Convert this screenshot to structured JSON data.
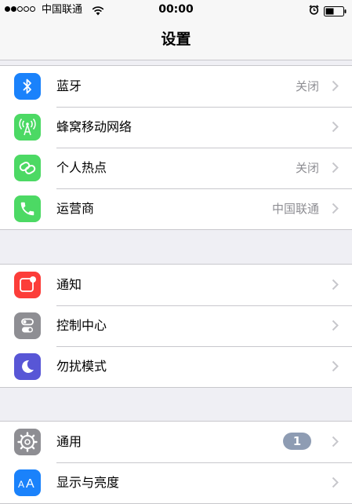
{
  "status_bar": {
    "carrier": "中国联通",
    "time": "00:00"
  },
  "nav": {
    "title": "设置"
  },
  "groups": [
    {
      "rows": [
        {
          "label": "蓝牙",
          "value": "关闭",
          "icon": "bluetooth-icon",
          "color": "#1a82fb"
        },
        {
          "label": "蜂窝移动网络",
          "value": "",
          "icon": "cellular-antenna-icon",
          "color": "#4cd964"
        },
        {
          "label": "个人热点",
          "value": "关闭",
          "icon": "hotspot-link-icon",
          "color": "#4cd964"
        },
        {
          "label": "运营商",
          "value": "中国联通",
          "icon": "phone-icon",
          "color": "#4cd964"
        }
      ]
    },
    {
      "rows": [
        {
          "label": "通知",
          "value": "",
          "icon": "notifications-icon",
          "color": "#fc3d39"
        },
        {
          "label": "控制中心",
          "value": "",
          "icon": "control-center-toggles-icon",
          "color": "#8e8e93"
        },
        {
          "label": "勿扰模式",
          "value": "",
          "icon": "moon-icon",
          "color": "#5856d6"
        }
      ]
    },
    {
      "rows": [
        {
          "label": "通用",
          "value": "",
          "badge": "1",
          "icon": "gear-icon",
          "color": "#8e8e93"
        },
        {
          "label": "显示与亮度",
          "value": "",
          "icon": "display-aa-icon",
          "color": "#1a82fb"
        }
      ]
    }
  ]
}
